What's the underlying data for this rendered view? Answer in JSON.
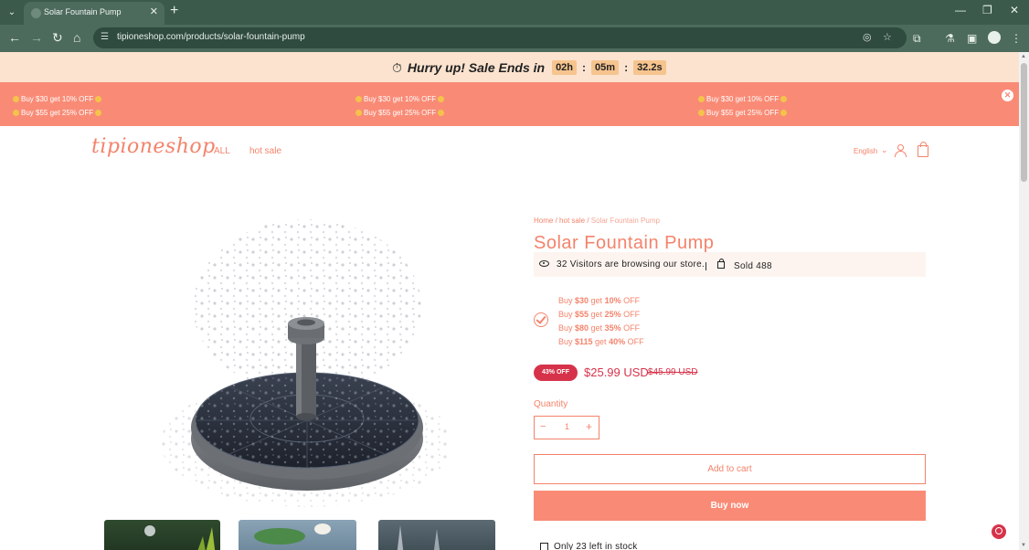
{
  "browser": {
    "tab_title": "Solar Fountain Pump",
    "tab_close": "✕",
    "new_tab": "+",
    "url": "tipioneshop.com/products/solar-fountain-pump",
    "window_minimize": "—",
    "window_restore": "❐",
    "window_close": "✕"
  },
  "countdown": {
    "label": "Hurry up! Sale Ends in",
    "hours": "02h",
    "minutes": "05m",
    "seconds": "32.2s",
    "separator": ":"
  },
  "promo": {
    "line1": "Buy $30 get 10% OFF",
    "line2": "Buy $55 get 25% OFF",
    "close": "✕"
  },
  "header": {
    "logo": "tipioneshop",
    "nav": [
      "ALL",
      "hot sale"
    ],
    "language": "English"
  },
  "product": {
    "breadcrumb": {
      "home": "Home",
      "sep": "/",
      "category": "hot sale",
      "current": "Solar Fountain Pump"
    },
    "title": "Solar Fountain Pump",
    "visitors": "32 Visitors are browsing our store.",
    "sold": "Sold 488",
    "tiers": [
      {
        "prefix": "Buy ",
        "amount": "$30",
        "mid": " get ",
        "pct": "10%",
        "suffix": " OFF"
      },
      {
        "prefix": "Buy ",
        "amount": "$55",
        "mid": " get ",
        "pct": "25%",
        "suffix": " OFF"
      },
      {
        "prefix": "Buy ",
        "amount": "$80",
        "mid": " get ",
        "pct": "35%",
        "suffix": " OFF"
      },
      {
        "prefix": "Buy ",
        "amount": "$115",
        "mid": " get ",
        "pct": "40%",
        "suffix": " OFF"
      }
    ],
    "discount_badge": "43% OFF",
    "price": "$25.99 USD",
    "compare_price": "$45.99 USD",
    "quantity_label": "Quantity",
    "quantity": "1",
    "add_to_cart": "Add to cart",
    "buy_now": "Buy now",
    "stock": "Only 23 left in stock"
  },
  "colors": {
    "brand": "#f4836b",
    "promo_bg": "#f98b76",
    "countdown_bg": "#fbe3cf",
    "sale_red": "#d6334a",
    "chrome": "#4d6b5d"
  }
}
